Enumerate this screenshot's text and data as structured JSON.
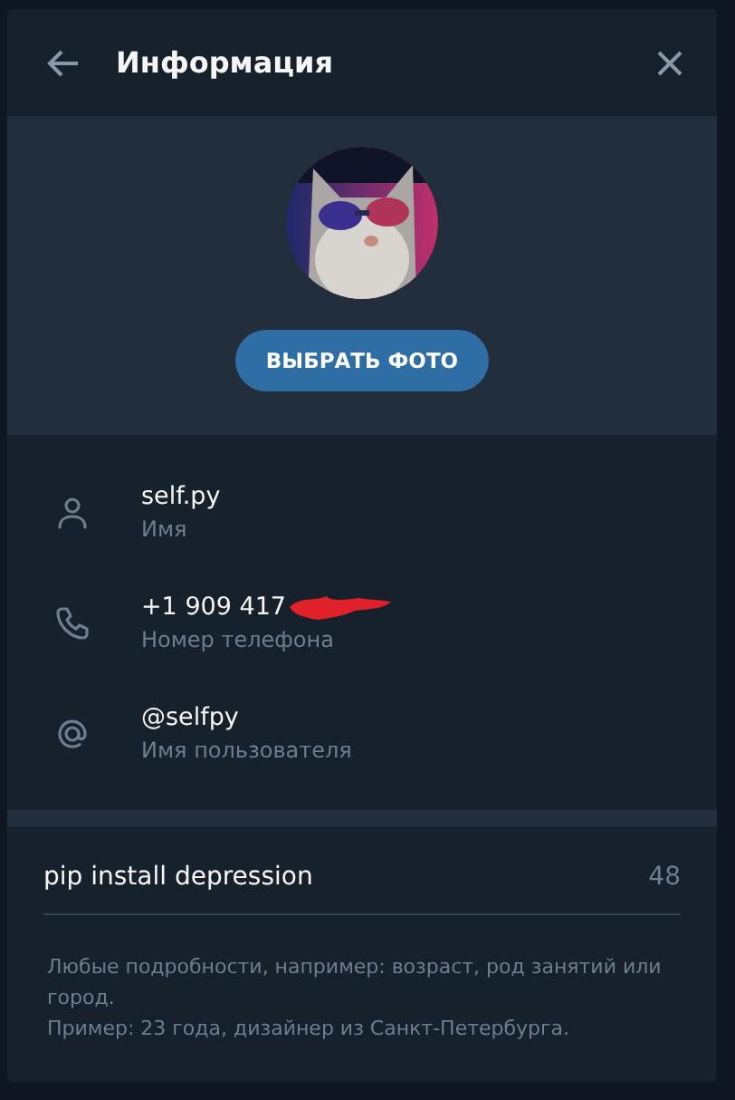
{
  "header": {
    "title": "Информация"
  },
  "photo": {
    "kind": "picture",
    "button": "ВЫБРАТЬ ФОТО"
  },
  "fields": [
    {
      "kind": "person",
      "value": "self.py",
      "label": "Имя",
      "redacted": false
    },
    {
      "kind": "phone",
      "value": "+1 909 417",
      "label": "Номер телефона",
      "redacted": true
    },
    {
      "kind": "username",
      "value": "@selfpy",
      "label": "Имя пользователя",
      "redacted": false
    }
  ],
  "bio": {
    "value": "pip install depression",
    "counter": "48"
  },
  "hints": [
    "Любые подробности, например: возраст, род занятий или город.",
    "Пример: 23 года, дизайнер из Санкт-Петербурга."
  ]
}
